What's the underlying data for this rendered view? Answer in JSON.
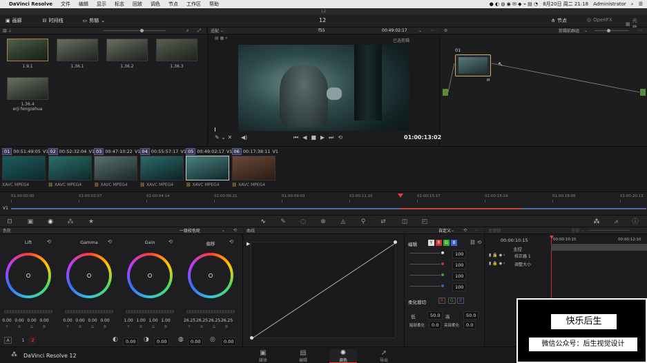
{
  "menubar": {
    "app": "DaVinci Resolve",
    "items": [
      "文件",
      "编辑",
      "显示",
      "标志",
      "回放",
      "调色",
      "节点",
      "工作区",
      "帮助"
    ],
    "datetime": "8月20日 周二 21:18",
    "user": "Administrator"
  },
  "window": {
    "title": "12"
  },
  "toolbar": {
    "media_pool": "画廊",
    "timeline": "时间线",
    "clips": "剪辑",
    "project_name": "12",
    "nodes": "节点",
    "openfx": "OpenFX",
    "lightbox": "光箱"
  },
  "gallery": {
    "stills": [
      {
        "label": "1.9.1"
      },
      {
        "label": "1.36.1"
      },
      {
        "label": "1.36.2"
      },
      {
        "label": "1.36.3"
      },
      {
        "label": "1.36.4",
        "sub": "erji fengzehua"
      }
    ]
  },
  "viewer": {
    "fit": "适配",
    "clip_name": "f55",
    "timecode_top": "00:49:02:17",
    "mode": "已选剪辑",
    "timecode": "01:00:13:02"
  },
  "node_editor": {
    "mode": "剪辑前群组",
    "node_label": "01"
  },
  "timeline_clips": [
    {
      "num": "01",
      "tc": "00:51:49:05",
      "track": "V1",
      "fmt": "XAVC MPEG4"
    },
    {
      "num": "02",
      "tc": "00:52:32:04",
      "track": "V1",
      "fmt": "XAVC MPEG4"
    },
    {
      "num": "03",
      "tc": "00:47:10:22",
      "track": "V1",
      "fmt": "XAVC MPEG4"
    },
    {
      "num": "04",
      "tc": "00:55:57:17",
      "track": "V1",
      "fmt": "XAVC MPEG4"
    },
    {
      "num": "05",
      "tc": "00:49:02:17",
      "track": "V1",
      "fmt": "XAVC MPEG4"
    },
    {
      "num": "06",
      "tc": "00:17:38:11",
      "track": "V1",
      "fmt": "XAVC MPEG4"
    }
  ],
  "ruler": {
    "marks": [
      "01:00:00:00",
      "01:00:02:07",
      "01:00:04:14",
      "01:00:06:21",
      "01:00:09:03",
      "01:00:11:10",
      "01:00:13:17",
      "01:00:15:24",
      "01:00:18:06",
      "01:00:20:13"
    ],
    "track": "V1"
  },
  "color_wheels": {
    "title": "色轮",
    "mode": "一级校色轮",
    "wheels": [
      {
        "name": "Lift",
        "vals": [
          "0.00",
          "0.00",
          "0.00",
          "0.00"
        ],
        "ch": [
          "Y",
          "R",
          "G",
          "B"
        ]
      },
      {
        "name": "Gamma",
        "vals": [
          "0.00",
          "0.00",
          "0.00",
          "0.00"
        ],
        "ch": [
          "Y",
          "R",
          "G",
          "B"
        ]
      },
      {
        "name": "Gain",
        "vals": [
          "1.00",
          "1.00",
          "1.00",
          "1.00"
        ],
        "ch": [
          "Y",
          "R",
          "G",
          "B"
        ]
      },
      {
        "name": "偏移",
        "vals": [
          "26.25",
          "26.25",
          "26.25",
          "26.25"
        ],
        "ch": [
          "Y",
          "R",
          "G",
          "B"
        ]
      }
    ],
    "bottom": {
      "a": "A",
      "p1": "1",
      "p2": "2",
      "v1": "0.00",
      "v2": "0.00",
      "v3": "0.00",
      "v4": "0.00"
    }
  },
  "curves": {
    "title": "曲线",
    "preset": "自定义"
  },
  "edit_panel": {
    "title": "编辑",
    "channels": [
      "Y",
      "R",
      "G",
      "B"
    ],
    "values": [
      "100",
      "100",
      "100",
      "100"
    ],
    "soft_clip": "柔化裁切",
    "low_label": "低",
    "low": "50.0",
    "high_label": "高",
    "high": "50.0",
    "ls_label": "暗部柔化",
    "ls": "0.0",
    "hs_label": "亮部柔化",
    "hs": "0.0"
  },
  "keyframes": {
    "title": "关键帧",
    "filter": "全部",
    "tc1": "00:00:10:15",
    "tc2": "00:00:12:10",
    "master": "主控",
    "item1": "校正器 1",
    "item2": "调整大小"
  },
  "pages": {
    "brand": "DaVinci Resolve 12",
    "items": [
      "媒体",
      "编辑",
      "调色",
      "导出"
    ]
  },
  "watermark": {
    "line1": "快乐后生",
    "line2": "微信公众号：后生视觉设计"
  }
}
